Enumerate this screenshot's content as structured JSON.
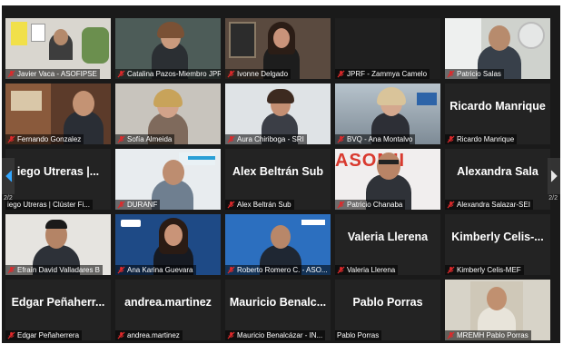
{
  "pagination": {
    "left": "2/2",
    "right": "2/2"
  },
  "colors": {
    "muted_icon": "#e0292b",
    "tile_bg": "#222222",
    "active_speaker_border": "#2f7bff"
  },
  "tiles": [
    {
      "caption": "Javier Vaca - ASOFIPSE",
      "name": "",
      "video": true,
      "bg": "#d9d6cf",
      "muted": true
    },
    {
      "caption": "Catalina Pazos-Miembro JPRF",
      "name": "",
      "video": true,
      "bg": "#4d5c58",
      "muted": true
    },
    {
      "caption": "Ivonne Delgado",
      "name": "",
      "video": true,
      "bg": "#5a4a3f",
      "muted": true
    },
    {
      "caption": "JPRF - Zammya Camelo",
      "name": "",
      "video": false,
      "bg": "#1f1f1f",
      "muted": true
    },
    {
      "caption": "Patricio Salas",
      "name": "",
      "video": true,
      "bg": "#cfd2cd",
      "muted": true
    },
    {
      "caption": "Fernando Gonzalez",
      "name": "",
      "video": true,
      "bg": "#5c3b2a",
      "muted": true
    },
    {
      "caption": "Sofía Almeida",
      "name": "",
      "video": true,
      "bg": "#c8c4bd",
      "muted": true
    },
    {
      "caption": "Aura Chiriboga - SRI",
      "name": "",
      "video": true,
      "bg": "#dfe3e6",
      "muted": true
    },
    {
      "caption": "BVQ - Ana Montalvo",
      "name": "",
      "video": true,
      "bg": "#9aa7b2",
      "muted": true
    },
    {
      "caption": "Ricardo Manrique",
      "name": "Ricardo Manrique",
      "video": false,
      "bg": "#232323",
      "muted": true
    },
    {
      "caption": "iego Utreras | Clúster Fi...",
      "name": "iego Utreras |...",
      "video": false,
      "bg": "#232323",
      "muted": false
    },
    {
      "caption": "DURANF",
      "name": "",
      "video": true,
      "bg": "#e8ecef",
      "muted": true
    },
    {
      "caption": "Alex Beltrán Sub",
      "name": "Alex Beltrán Sub",
      "video": false,
      "bg": "#232323",
      "muted": true
    },
    {
      "caption": "Patricio Chanaba",
      "name": "",
      "video": true,
      "bg": "#f1eeee",
      "muted": true
    },
    {
      "caption": "Alexandra Salazar-SEI",
      "name": "Alexandra Sala",
      "video": false,
      "bg": "#232323",
      "muted": true
    },
    {
      "caption": "Efraín David Valladares B",
      "name": "",
      "video": true,
      "bg": "#e6e4e0",
      "muted": true
    },
    {
      "caption": "Ana Karina Guevara",
      "name": "",
      "video": true,
      "bg": "#1e4a86",
      "muted": true
    },
    {
      "caption": "Roberto Romero C. - ASO...",
      "name": "",
      "video": true,
      "bg": "#2c6fbf",
      "muted": true
    },
    {
      "caption": "Valeria Llerena",
      "name": "Valeria Llerena",
      "video": false,
      "bg": "#232323",
      "muted": true
    },
    {
      "caption": "Kimberly Celis-MEF",
      "name": "Kimberly Celis-...",
      "video": false,
      "bg": "#232323",
      "muted": true
    },
    {
      "caption": "Edgar Peñaherrera",
      "name": "Edgar Peñaherr...",
      "video": false,
      "bg": "#232323",
      "muted": true
    },
    {
      "caption": "andrea.martinez",
      "name": "andrea.martinez",
      "video": false,
      "bg": "#232323",
      "muted": true
    },
    {
      "caption": "Mauricio Benalcázar - IN...",
      "name": "Mauricio Benalc...",
      "video": false,
      "bg": "#232323",
      "muted": true
    },
    {
      "caption": "Pablo Porras",
      "name": "Pablo Porras",
      "video": false,
      "bg": "#232323",
      "muted": false
    },
    {
      "caption": "MREMH  Pablo Porras",
      "name": "",
      "video": true,
      "bg": "#d7d3c8",
      "muted": true
    }
  ]
}
